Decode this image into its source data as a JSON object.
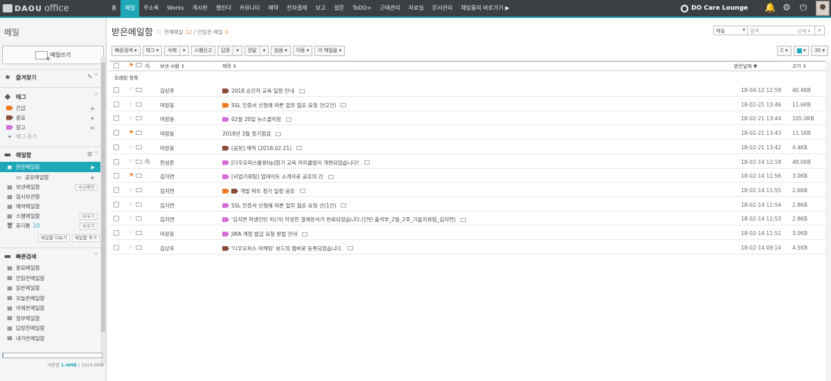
{
  "app": {
    "brand": "DAOU",
    "product": "office"
  },
  "gnb": [
    "홈",
    "메일",
    "주소록",
    "Works",
    "게시판",
    "캘린더",
    "커뮤니티",
    "예약",
    "전자결재",
    "보고",
    "설문",
    "ToDO+",
    "근태관리",
    "자료실",
    "문서관리",
    "채팅룸의 바로가기 ▶"
  ],
  "gnb_active": "메일",
  "topright": {
    "lounge": "DO Care Lounge"
  },
  "sidebar": {
    "title": "메일",
    "write_label": "메일쓰기",
    "favorites": "즐겨찾기",
    "tags_title": "태그",
    "tags": [
      {
        "label": "긴급",
        "color": "#f07a22"
      },
      {
        "label": "중요",
        "color": "#8a4b38"
      },
      {
        "label": "참고",
        "color": "#d76bd8"
      }
    ],
    "add_tag": "태그 추가",
    "mailbox_title": "메일함",
    "mailboxes": {
      "inbox": "받은메일함",
      "shared": "공유메일함",
      "sent": "보낸메일함",
      "sent_btn": "수신확인",
      "drafts": "임시보관함",
      "scheduled": "예약메일함",
      "spam": "스팸메일함",
      "spam_btn": "비우기",
      "trash": "휴지통",
      "trash_count": "10",
      "trash_btn": "비우기"
    },
    "more_mailbox": "메일함 더보기",
    "add_mailbox": "메일함 추가",
    "quick_title": "빠른검색",
    "quick": [
      "중요메일함",
      "안읽은메일함",
      "읽은메일함",
      "오늘온메일함",
      "어제온메일함",
      "첨부메일함",
      "답장한메일함",
      "내가쓴메일함"
    ],
    "usage": {
      "used_label": "사용량",
      "used": "1.4MB",
      "total": "1024.0MB",
      "ratio": 0.0014
    }
  },
  "main": {
    "title": "받은메일함",
    "total_label": "전체메일",
    "total": "12",
    "unread_label": "/ 안읽은 메일",
    "unread": "0",
    "search": {
      "scope": "메일",
      "placeholder": "검색",
      "detail": "상세 ▾"
    },
    "toolbar": {
      "quick": "빠른검색 ▾",
      "tag": "태그 ▾",
      "delete": "삭제",
      "spam": "스팸신고",
      "reply": "답장",
      "forward": "전달",
      "read": "읽음 ▾",
      "move": "이동 ▾",
      "this_mail": "이 메일을 ▾",
      "refresh": "C ▾",
      "view": "▾",
      "page_size": "20 ▾"
    },
    "columns": {
      "sender": "보낸 사람 ⇕",
      "subject": "제목 ⇕",
      "date": "받은날짜 ▼",
      "size": "크기 ⇕"
    },
    "group_label": "오래된 항목",
    "rows": [
      {
        "sender": "김상후",
        "subject": "2018 승진자 교육 일정 안내",
        "tag": "#8a4b38",
        "date": "18-04-12 12:59",
        "size": "40.4KB",
        "flag": false,
        "attach": false
      },
      {
        "sender": "마장웅",
        "subject": "SSL 인증서 신청에 따른 업무 협조 요청 건(2건)",
        "tag": "#f07a22",
        "date": "18-02-21 13:46",
        "size": "11.6KB",
        "flag": false,
        "attach": false
      },
      {
        "sender": "마장웅",
        "subject": "02월 20일 뉴스클리핑",
        "tag": "#d76bd8",
        "date": "18-02-21 13:44",
        "size": "105.0KB",
        "flag": false,
        "attach": false
      },
      {
        "sender": "마장웅",
        "subject": "2018년 3월 정기점검",
        "tag": "",
        "date": "18-02-21 13:43",
        "size": "11.1KB",
        "flag": true,
        "attach": false
      },
      {
        "sender": "마장웅",
        "subject": "[공문] 채직 (2018.02.21)",
        "tag": "#8a4b38",
        "date": "18-02-21 13:42",
        "size": "4.4KB",
        "flag": false,
        "attach": false
      },
      {
        "sender": "한성준",
        "subject": "[다우오피스활용tip]정기 교육 커리큘럼이 개편되었습니다!",
        "tag": "#d76bd8",
        "date": "18-02-14 12:18",
        "size": "48.0KB",
        "flag": false,
        "attach": true
      },
      {
        "sender": "김지연",
        "subject": "[사업기획팀] 업데이트 소개자료 공유의 건",
        "tag": "#d76bd8",
        "date": "18-02-14 11:56",
        "size": "3.0KB",
        "flag": true,
        "attach": false
      },
      {
        "sender": "김지연",
        "subject": "개발 파트 정기 일정 공유",
        "tag": "#f07a22",
        "tag2": "#8a4b38",
        "date": "18-02-14 11:55",
        "size": "2.6KB",
        "flag": false,
        "attach": false
      },
      {
        "sender": "김지연",
        "subject": "SSL 인증서 신청에 따른 업무 협조 요청 건(1건)",
        "tag": "#d76bd8",
        "date": "18-02-14 11:54",
        "size": "2.8KB",
        "flag": false,
        "attach": false
      },
      {
        "sender": "김지연",
        "subject": "'김지연 학생인턴 미(가) 작성한 결재문서가 완료되었습니다.(인턴 출석부_2월_2주_기술지원팀_김지연)",
        "tag": "#d76bd8",
        "date": "18-02-14 11:53",
        "size": "2.8KB",
        "flag": false,
        "attach": false
      },
      {
        "sender": "마장웅",
        "subject": "JIRA 계정 발급 요청 방법 안내",
        "tag": "#d76bd8",
        "date": "18-02-14 11:51",
        "size": "3.0KB",
        "flag": false,
        "attach": false
      },
      {
        "sender": "김상후",
        "subject": "'다우오피스 마케팅' 보드의 멤버로 등록되었습니다.",
        "tag": "#8a4b38",
        "date": "18-02-14 09:14",
        "size": "4.5KB",
        "flag": false,
        "attach": false
      }
    ]
  }
}
